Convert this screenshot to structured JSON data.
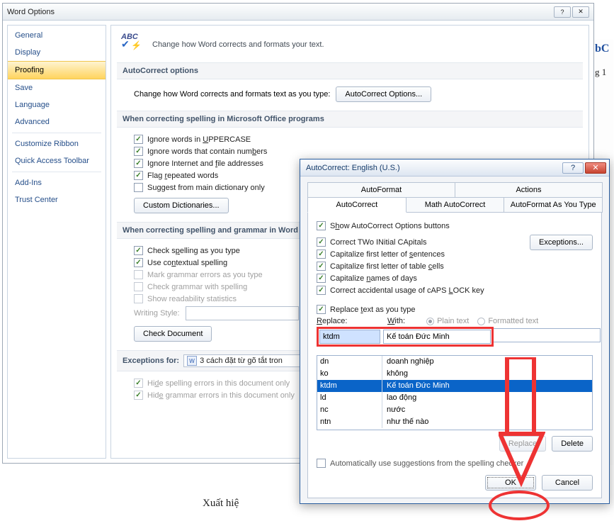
{
  "wordOptions": {
    "title": "Word Options",
    "help": "?",
    "close": "✕",
    "nav": {
      "general": "General",
      "display": "Display",
      "proofing": "Proofing",
      "save": "Save",
      "language": "Language",
      "advanced": "Advanced",
      "customizeRibbon": "Customize Ribbon",
      "quickAccess": "Quick Access Toolbar",
      "addIns": "Add-Ins",
      "trustCenter": "Trust Center"
    },
    "header": {
      "abc": "ABC",
      "text": "Change how Word corrects and formats your text."
    },
    "sectAutoCorrect": "AutoCorrect options",
    "autoCorrectRowLabel": "Change how Word corrects and formats text as you type:",
    "autoCorrectBtn": "AutoCorrect Options...",
    "sectSpelling": "When correcting spelling in Microsoft Office programs",
    "chkUppercase": "Ignore words in UPPERCASE",
    "chkNumbers": "Ignore words that contain numbers",
    "chkInternet": "Ignore Internet and file addresses",
    "chkRepeated": "Flag repeated words",
    "chkMainDict": "Suggest from main dictionary only",
    "btnCustomDict": "Custom Dictionaries...",
    "sectGrammar": "When correcting spelling and grammar in Word",
    "chkSpellType": "Check spelling as you type",
    "chkContextual": "Use contextual spelling",
    "chkMarkGrammar": "Mark grammar errors as you type",
    "chkCheckGrammar": "Check grammar with spelling",
    "chkReadability": "Show readability statistics",
    "writingStyle": "Writing Style:",
    "btnCheckDoc": "Check Document",
    "exceptionsFor": "Exceptions for:",
    "exceptionsDoc": "3 cách đặt từ gõ tắt tron",
    "chkHideSpell": "Hide spelling errors in this document only",
    "chkHideGrammar": "Hide grammar errors in this document only"
  },
  "autoCorrect": {
    "title": "AutoCorrect: English (U.S.)",
    "help": "?",
    "close": "✕",
    "tabs": {
      "autoFormat": "AutoFormat",
      "actions": "Actions",
      "autoCorrect": "AutoCorrect",
      "mathAutoCorrect": "Math AutoCorrect",
      "asYouType": "AutoFormat As You Type"
    },
    "chkShowBtns": "Show AutoCorrect Options buttons",
    "chkTwoCaps": "Correct TWo INitial CApitals",
    "btnExceptions": "Exceptions...",
    "chkSentence": "Capitalize first letter of sentences",
    "chkTableCells": "Capitalize first letter of table cells",
    "chkDays": "Capitalize names of days",
    "chkCapsLock": "Correct accidental usage of cAPS LOCK key",
    "chkReplaceType": "Replace text as you type",
    "lblReplace": "Replace:",
    "lblWith": "With:",
    "radPlain": "Plain text",
    "radFormatted": "Formatted text",
    "inputReplace": "ktdm",
    "inputWith": "Kế toán Đức Minh",
    "list": [
      {
        "k": "dn",
        "v": "doanh nghiệp"
      },
      {
        "k": "ko",
        "v": "không"
      },
      {
        "k": "ktdm",
        "v": "Kế toán Đức Minh",
        "sel": true
      },
      {
        "k": "ld",
        "v": "lao động"
      },
      {
        "k": "nc",
        "v": "nước"
      },
      {
        "k": "ntn",
        "v": "như thế nào"
      }
    ],
    "btnReplace": "Replace",
    "btnDelete": "Delete",
    "chkAutoSuggest": "Automatically use suggestions from the spelling checker",
    "btnOK": "OK",
    "btnCancel": "Cancel"
  },
  "bgText": "Xuất hiệ",
  "bgSnip": "bC",
  "bgSnip2": "g 1"
}
